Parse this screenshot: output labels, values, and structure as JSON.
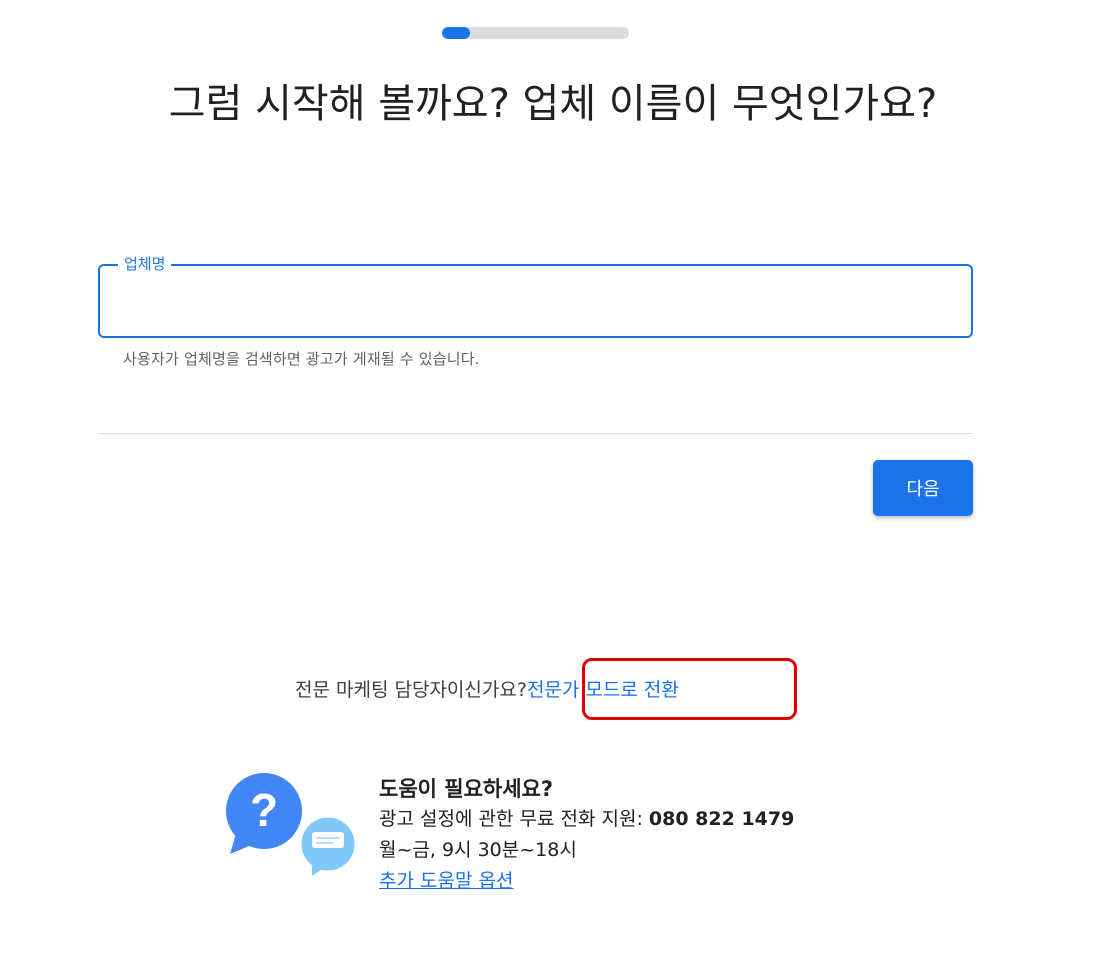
{
  "progress": {
    "fraction": 0.15,
    "accent_color": "#1a73e8",
    "track_color": "#dadce0"
  },
  "title": "그럼 시작해 볼까요? 업체 이름이 무엇인가요?",
  "business_field": {
    "label": "업체명",
    "value": "",
    "helper": "사용자가 업체명을 검색하면 광고가 게재될 수 있습니다."
  },
  "next_button": {
    "label": "다음"
  },
  "expert": {
    "prompt": "전문 마케팅 담당자이신가요?",
    "link": "전문가 모드로 전환",
    "highlight_color": "#e00000"
  },
  "help": {
    "title": "도움이 필요하세요?",
    "phone_prefix": "광고 설정에 관한 무료 전화 지원: ",
    "phone_number": "080 822 1479",
    "hours": "월~금, 9시 30분~18시",
    "more_link": "추가 도움말 옵션",
    "icons": [
      "question-bubble-icon",
      "chat-bubble-icon"
    ],
    "icon_glyph": "?"
  }
}
